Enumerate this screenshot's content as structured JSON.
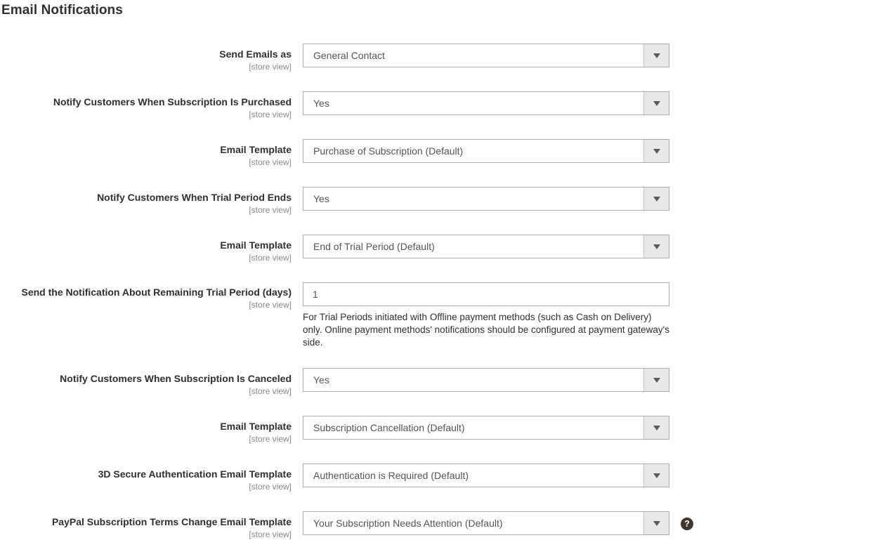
{
  "section": {
    "title": "Email Notifications"
  },
  "common": {
    "scope_label": "[store view]",
    "caret_icon": "chevron-down-icon",
    "help_icon": "question-mark-icon",
    "help_icon_glyph": "?",
    "help_icon_color": "#41362f",
    "border_color": "#adadad",
    "arrow_button_color": "#e9e9e9",
    "label_color": "#303030",
    "scope_color": "#8a8a8a",
    "value_color": "#555555"
  },
  "fields": [
    {
      "id": "send-emails-as",
      "label": "Send Emails as",
      "scope": "[store view]",
      "type": "select",
      "value": "General Contact"
    },
    {
      "id": "notify-subscription-purchased",
      "label": "Notify Customers When Subscription Is Purchased",
      "scope": "[store view]",
      "type": "select",
      "value": "Yes"
    },
    {
      "id": "email-template-purchase",
      "label": "Email Template",
      "scope": "[store view]",
      "type": "select",
      "value": "Purchase of Subscription (Default)"
    },
    {
      "id": "notify-trial-period-ends",
      "label": "Notify Customers When Trial Period Ends",
      "scope": "[store view]",
      "type": "select",
      "value": "Yes"
    },
    {
      "id": "email-template-trial-end",
      "label": "Email Template",
      "scope": "[store view]",
      "type": "select",
      "value": "End of Trial Period (Default)"
    },
    {
      "id": "remaining-trial-period-days",
      "label": "Send the Notification About Remaining Trial Period (days)",
      "scope": "[store view]",
      "type": "text",
      "value": "1",
      "note": "For Trial Periods initiated with Offline payment methods (such as Cash on Delivery) only. Online payment methods' notifications should be configured at payment gateway's side."
    },
    {
      "id": "notify-subscription-canceled",
      "label": "Notify Customers When Subscription Is Canceled",
      "scope": "[store view]",
      "type": "select",
      "value": "Yes"
    },
    {
      "id": "email-template-cancellation",
      "label": "Email Template",
      "scope": "[store view]",
      "type": "select",
      "value": "Subscription Cancellation (Default)"
    },
    {
      "id": "email-template-3d-secure",
      "label": "3D Secure Authentication Email Template",
      "scope": "[store view]",
      "type": "select",
      "value": "Authentication is Required (Default)"
    },
    {
      "id": "email-template-paypal-terms-change",
      "label": "PayPal Subscription Terms Change Email Template",
      "scope": "[store view]",
      "type": "select",
      "value": "Your Subscription Needs Attention (Default)",
      "has_tooltip": true
    }
  ]
}
